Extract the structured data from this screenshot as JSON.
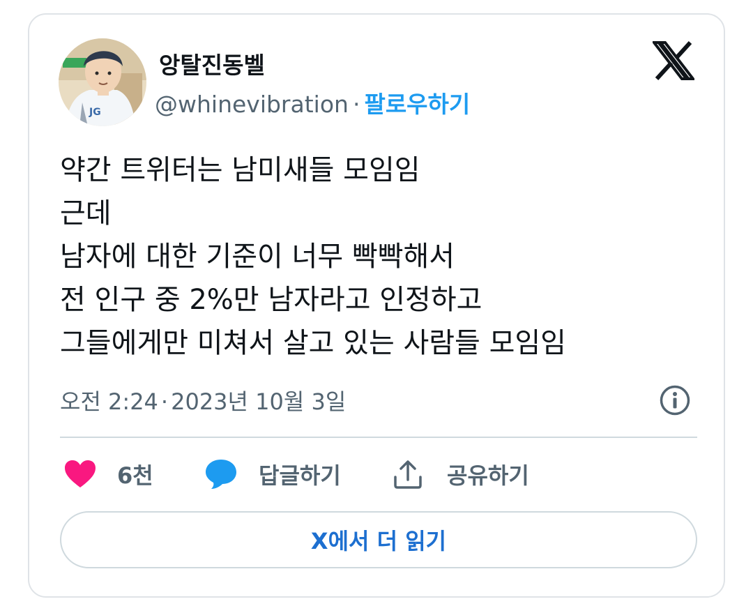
{
  "author": {
    "display_name": "앙탈진동벨",
    "handle": "@whinevibration",
    "separator": "·",
    "follow_label": "팔로우하기",
    "avatar_icon": "profile-photo-anime-boy-jersey"
  },
  "brand": {
    "logo_icon": "x-logo-icon"
  },
  "tweet": {
    "lines": [
      "약간 트위터는 남미새들 모임임",
      "근데",
      "남자에 대한 기준이 너무 빡빡해서",
      "전 인구 중 2%만 남자라고 인정하고",
      "그들에게만 미쳐서 살고 있는 사람들 모임임"
    ],
    "time": "오전 2:24",
    "separator": "·",
    "date": "2023년 10월 3일"
  },
  "actions": {
    "like_count": "6천",
    "reply_label": "답글하기",
    "share_label": "공유하기"
  },
  "read_more_label": "X에서 더 읽기",
  "colors": {
    "text_primary": "#0f1419",
    "text_secondary": "#536471",
    "link": "#1d9bf0",
    "read_more": "#1d6fd0",
    "like": "#f91880",
    "reply": "#1d9bf0",
    "border": "#cfd9de"
  }
}
